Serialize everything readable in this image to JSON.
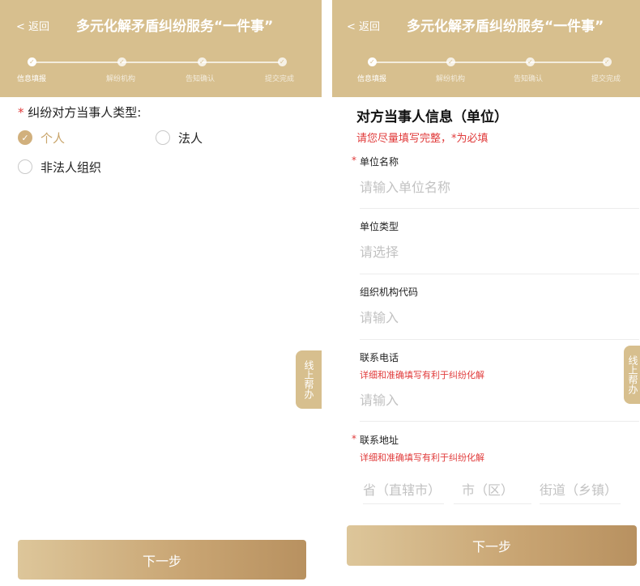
{
  "colors": {
    "header": "#d7bf8e",
    "accent": "#c9a56b",
    "required": "#e03a3a",
    "placeholder": "#c2c2c2"
  },
  "header": {
    "back_label": "< 返回",
    "title": "多元化解矛盾纠纷服务“一件事”",
    "steps": [
      "信息填报",
      "解纷机构",
      "告知确认",
      "提交完成"
    ],
    "active_step": 1
  },
  "left": {
    "question": {
      "required_mark": "*",
      "label": "纠纷对方当事人类型:",
      "options": [
        "个人",
        "法人",
        "非法人组织"
      ],
      "selected": "个人"
    },
    "help_tab": "线上帮办",
    "next_button": "下一步"
  },
  "right": {
    "section_title": "对方当事人信息（单位）",
    "section_tip": "请您尽量填写完整，*为必填",
    "fields": [
      {
        "required": "*",
        "label": "单位名称",
        "placeholder": "请输入单位名称"
      },
      {
        "required": "",
        "label": "单位类型",
        "placeholder": "请选择"
      },
      {
        "required": "",
        "label": "组织机构代码",
        "placeholder": "请输入"
      },
      {
        "required": "",
        "label": "联系电话",
        "hint": "详细和准确填写有利于纠纷化解",
        "placeholder": "请输入"
      },
      {
        "required": "*",
        "label": "联系地址",
        "hint": "详细和准确填写有利于纠纷化解"
      }
    ],
    "address": {
      "province": "省（直辖市）",
      "city": "市（区）",
      "street": "街道（乡镇）"
    },
    "help_tab": "线上帮办",
    "next_button": "下一步"
  }
}
